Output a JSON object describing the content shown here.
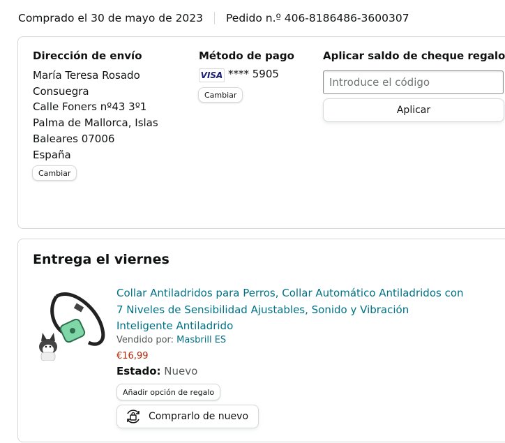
{
  "header": {
    "order_date": "Comprado el 30 de mayo de 2023",
    "order_number": "Pedido n.º 406-8186486-3600307"
  },
  "shipping": {
    "title": "Dirección de envío",
    "lines": [
      "María Teresa Rosado",
      "Consuegra",
      "Calle Foners nº43 3º1",
      "Palma de Mallorca, Islas",
      "Baleares 07006",
      "España"
    ],
    "change_label": "Cambiar"
  },
  "payment": {
    "title": "Método de pago",
    "card_brand": "VISA",
    "card_masked": "**** 5905",
    "change_label": "Cambiar"
  },
  "gift": {
    "title": "Aplicar saldo de cheque regalo",
    "placeholder": "Introduce el código",
    "apply_label": "Aplicar"
  },
  "delivery": {
    "title": "Entrega el viernes",
    "product": {
      "title": "Collar Antiladridos para Perros, Collar Automático Antiladridos con 7 Niveles de Sensibilidad Ajustables, Sonido y Vibración Inteligente Antiladrido",
      "seller_prefix": "Vendido por:",
      "seller_name": "Masbrill ES",
      "price": "€16,99",
      "state_label": "Estado:",
      "state_value": "Nuevo",
      "gift_option_label": "Añadir opción de regalo",
      "buy_again_label": "Comprarlo de nuevo"
    }
  },
  "colors": {
    "link": "#007185",
    "price": "#b12704",
    "border": "#d5d9d9",
    "visa_blue": "#1a1f71",
    "collar_green": "#7fd6a6"
  }
}
